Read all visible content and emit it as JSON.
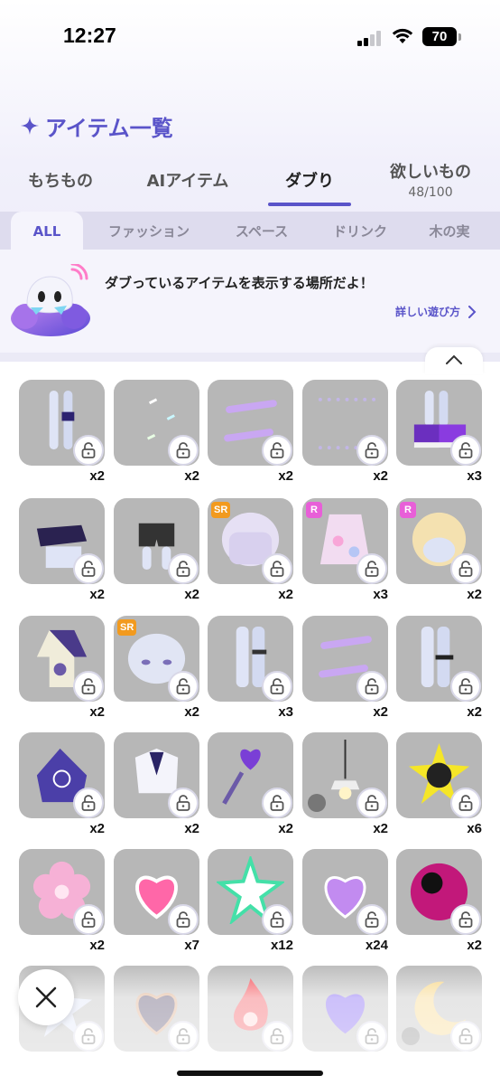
{
  "status": {
    "time": "12:27",
    "battery": "70"
  },
  "page": {
    "title": "アイテム一覧"
  },
  "main_tabs": [
    {
      "label": "もちもの",
      "sub": ""
    },
    {
      "label": "AIアイテム",
      "sub": ""
    },
    {
      "label": "ダブり",
      "sub": "",
      "active": true
    },
    {
      "label": "欲しいもの",
      "sub": "48/100"
    }
  ],
  "sub_tabs": [
    {
      "label": "ALL",
      "active": true
    },
    {
      "label": "ファッション"
    },
    {
      "label": "スペース"
    },
    {
      "label": "ドリンク"
    },
    {
      "label": "木の実"
    }
  ],
  "banner": {
    "message": "ダブっているアイテムを表示する場所だよ！",
    "link": "詳しい遊び方"
  },
  "items": [
    {
      "qty": "x2",
      "art": "legs-icon",
      "rarity": ""
    },
    {
      "qty": "x2",
      "art": "sparkle-stickers-icon",
      "rarity": ""
    },
    {
      "qty": "x2",
      "art": "text-stickers-icon",
      "rarity": ""
    },
    {
      "qty": "x2",
      "art": "dots-pattern-icon",
      "rarity": ""
    },
    {
      "qty": "x3",
      "art": "sneakers-icon",
      "rarity": ""
    },
    {
      "qty": "x2",
      "art": "crop-top-icon",
      "rarity": ""
    },
    {
      "qty": "x2",
      "art": "shorts-icon",
      "rarity": ""
    },
    {
      "qty": "x2",
      "art": "bob-hair-icon",
      "rarity": "SR"
    },
    {
      "qty": "x3",
      "art": "frilly-dress-icon",
      "rarity": "R"
    },
    {
      "qty": "x2",
      "art": "blonde-hair-icon",
      "rarity": "R"
    },
    {
      "qty": "x2",
      "art": "kimono-icon",
      "rarity": ""
    },
    {
      "qty": "x2",
      "art": "face-icon",
      "rarity": "SR"
    },
    {
      "qty": "x3",
      "art": "leg-garter-icon",
      "rarity": ""
    },
    {
      "qty": "x2",
      "art": "text-stickers-icon",
      "rarity": ""
    },
    {
      "qty": "x2",
      "art": "leg-band-icon",
      "rarity": ""
    },
    {
      "qty": "x2",
      "art": "smiley-poncho-icon",
      "rarity": ""
    },
    {
      "qty": "x2",
      "art": "sailor-top-icon",
      "rarity": ""
    },
    {
      "qty": "x2",
      "art": "heart-wand-icon",
      "rarity": ""
    },
    {
      "qty": "x2",
      "art": "pendant-lamp-icon",
      "rarity": "",
      "hidden": true
    },
    {
      "qty": "x6",
      "art": "black-star-icon",
      "rarity": ""
    },
    {
      "qty": "x2",
      "art": "sakura-flower-icon",
      "rarity": ""
    },
    {
      "qty": "x7",
      "art": "pink-heart-icon",
      "rarity": ""
    },
    {
      "qty": "x12",
      "art": "green-star-icon",
      "rarity": ""
    },
    {
      "qty": "x24",
      "art": "pixel-heart-icon",
      "rarity": ""
    },
    {
      "qty": "x2",
      "art": "eyeball-icon",
      "rarity": ""
    },
    {
      "qty": "",
      "art": "blue-star-icon",
      "rarity": ""
    },
    {
      "qty": "",
      "art": "dark-heart-icon",
      "rarity": ""
    },
    {
      "qty": "",
      "art": "flame-icon",
      "rarity": ""
    },
    {
      "qty": "",
      "art": "purple-heart-icon",
      "rarity": ""
    },
    {
      "qty": "",
      "art": "crescent-moon-icon",
      "rarity": "",
      "hidden": true
    }
  ],
  "colors": {
    "accent": "#5a54c9",
    "tile": "#b7b7b7"
  }
}
